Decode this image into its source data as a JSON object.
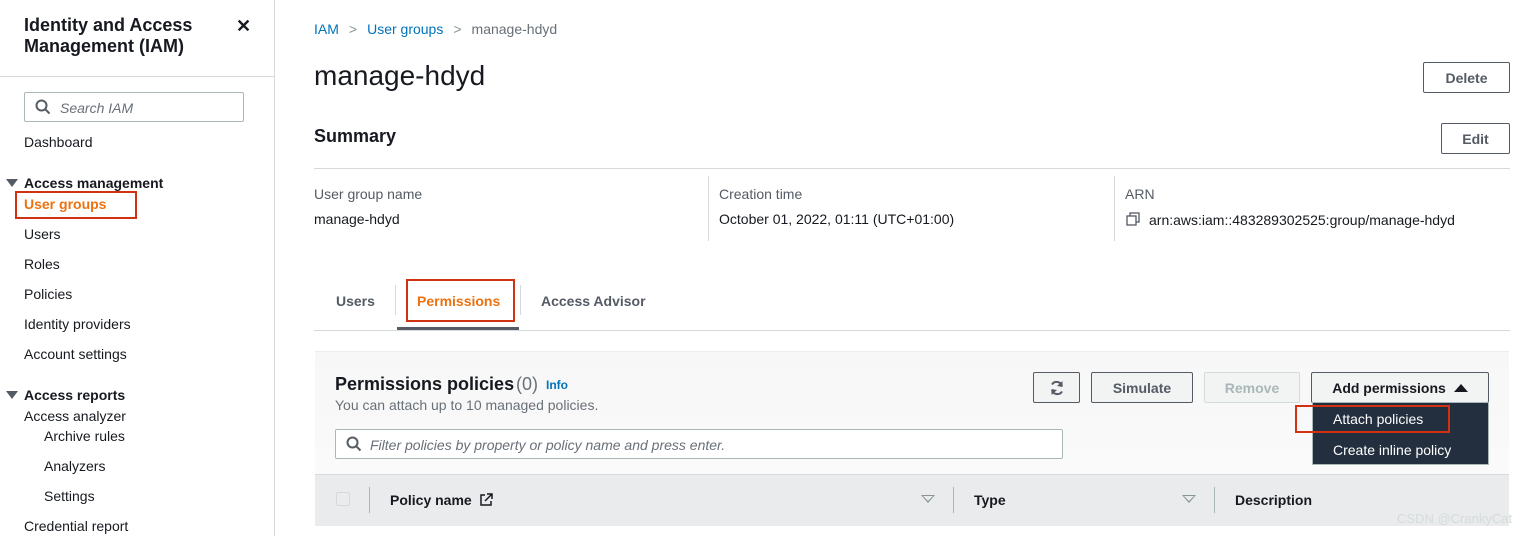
{
  "sidebar": {
    "title": "Identity and Access Management (IAM)",
    "close_icon": "close-icon",
    "search_placeholder": "Search IAM",
    "dashboard": "Dashboard",
    "access_management": {
      "label": "Access management",
      "items": [
        "User groups",
        "Users",
        "Roles",
        "Policies",
        "Identity providers",
        "Account settings"
      ]
    },
    "access_reports": {
      "label": "Access reports",
      "analyzer": "Access analyzer",
      "sub_items": [
        "Archive rules",
        "Analyzers",
        "Settings"
      ],
      "credential_report": "Credential report"
    }
  },
  "breadcrumb": {
    "items": [
      "IAM",
      "User groups",
      "manage-hdyd"
    ]
  },
  "page": {
    "title": "manage-hdyd",
    "delete_label": "Delete"
  },
  "summary": {
    "title": "Summary",
    "edit_label": "Edit",
    "group_name_label": "User group name",
    "group_name_value": "manage-hdyd",
    "creation_time_label": "Creation time",
    "creation_time_value": "October 01, 2022, 01:11 (UTC+01:00)",
    "arn_label": "ARN",
    "arn_value": "arn:aws:iam::483289302525:group/manage-hdyd"
  },
  "tabs": {
    "items": [
      "Users",
      "Permissions",
      "Access Advisor"
    ],
    "active": "Permissions"
  },
  "permissions": {
    "title": "Permissions policies",
    "count": "(0)",
    "info": "Info",
    "subtitle": "You can attach up to 10 managed policies.",
    "filter_placeholder": "Filter policies by property or policy name and press enter.",
    "simulate_label": "Simulate",
    "remove_label": "Remove",
    "add_permissions_label": "Add permissions",
    "dropdown": [
      "Attach policies",
      "Create inline policy"
    ],
    "columns": [
      "Policy name",
      "Type",
      "Description"
    ]
  },
  "watermark": "CSDN @CrankyCat",
  "colors": {
    "accent": "#ec7211",
    "link": "#0073bb",
    "highlight": "#d13212",
    "dropdown_bg": "#232f3e"
  }
}
